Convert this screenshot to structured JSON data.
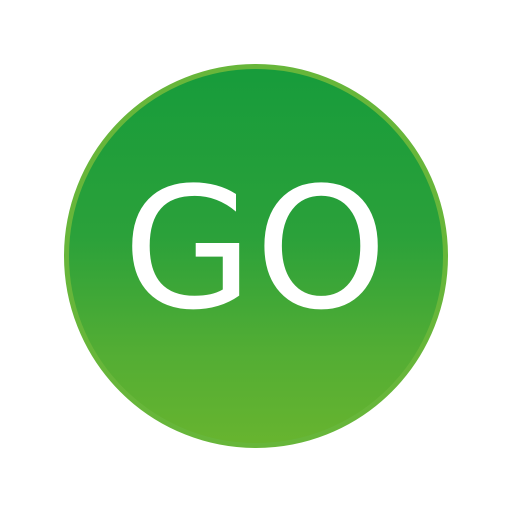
{
  "button": {
    "label": "GO"
  },
  "colors": {
    "background": "#ffffff",
    "circle_top": "#179c3b",
    "circle_bottom": "#67b42f",
    "border": "#67b63a",
    "text": "#ffffff"
  }
}
